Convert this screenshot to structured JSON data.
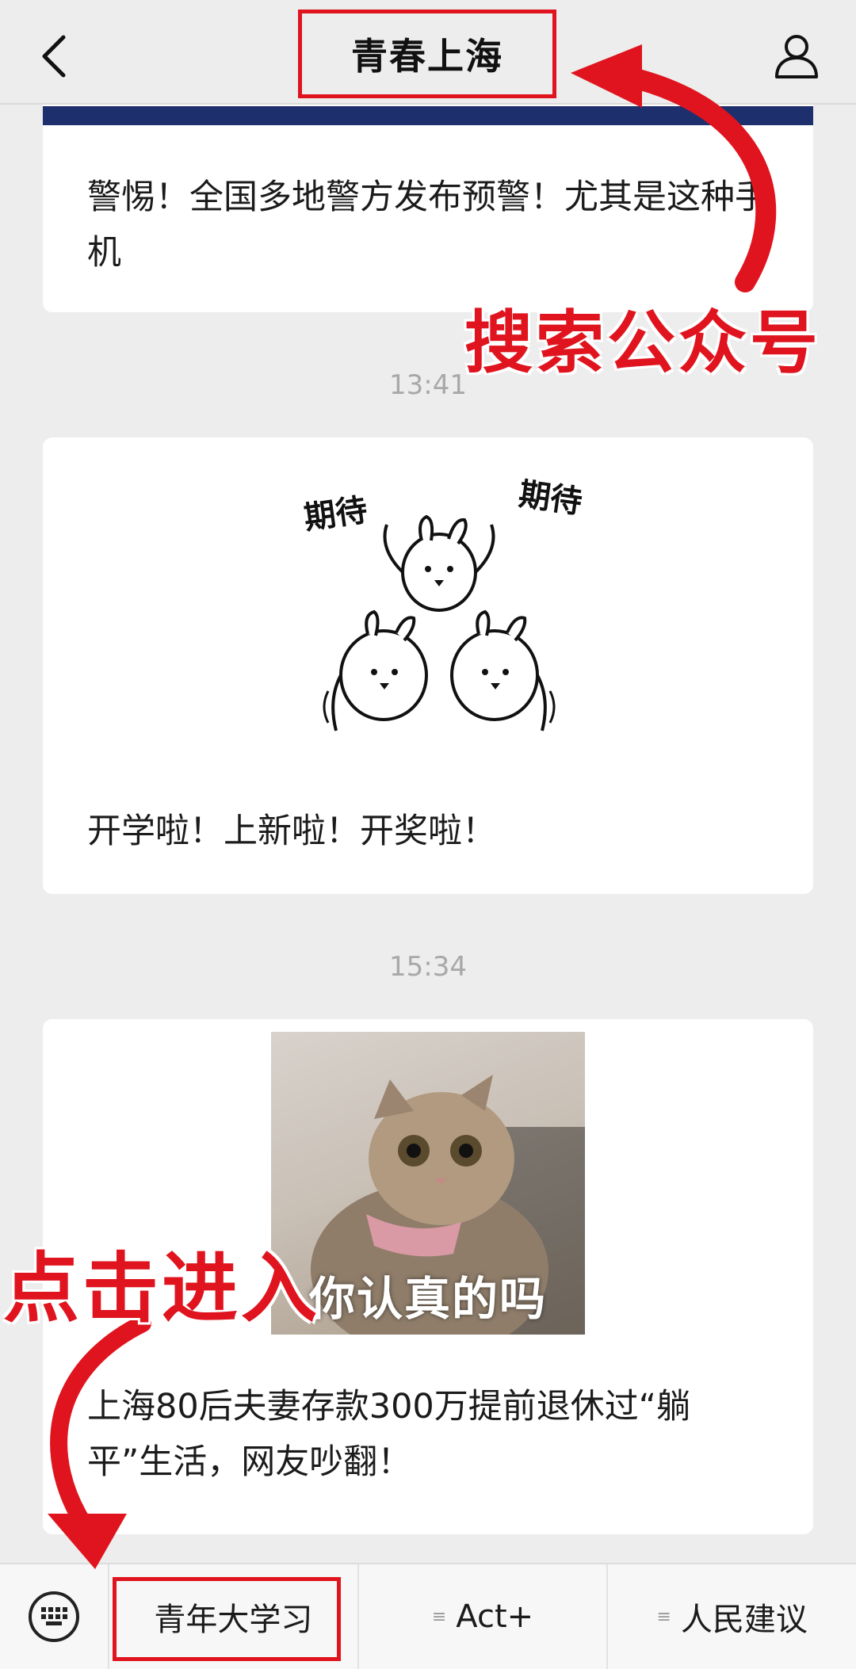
{
  "header": {
    "title": "青春上海",
    "back_icon": "chevron-left-icon",
    "profile_icon": "person-icon"
  },
  "messages": [
    {
      "title": "警惕！全国多地警方发布预警！尤其是这种手机"
    },
    {
      "timestamp": "13:41",
      "sticker_text_left": "期待",
      "sticker_text_right": "期待",
      "title": "开学啦！上新啦！开奖啦！"
    },
    {
      "timestamp": "15:34",
      "image_caption": "你认真的吗",
      "title": "上海80后夫妻存款300万提前退休过“躺平”生活，网友吵翻！"
    }
  ],
  "annotations": {
    "search": "搜索公众号",
    "click": "点击进入",
    "color": "#e0141e"
  },
  "bottom_menu": {
    "keyboard_icon": "keyboard-icon",
    "items": [
      {
        "label": "青年大学习"
      },
      {
        "label": "Act+"
      },
      {
        "label": "人民建议"
      }
    ]
  }
}
